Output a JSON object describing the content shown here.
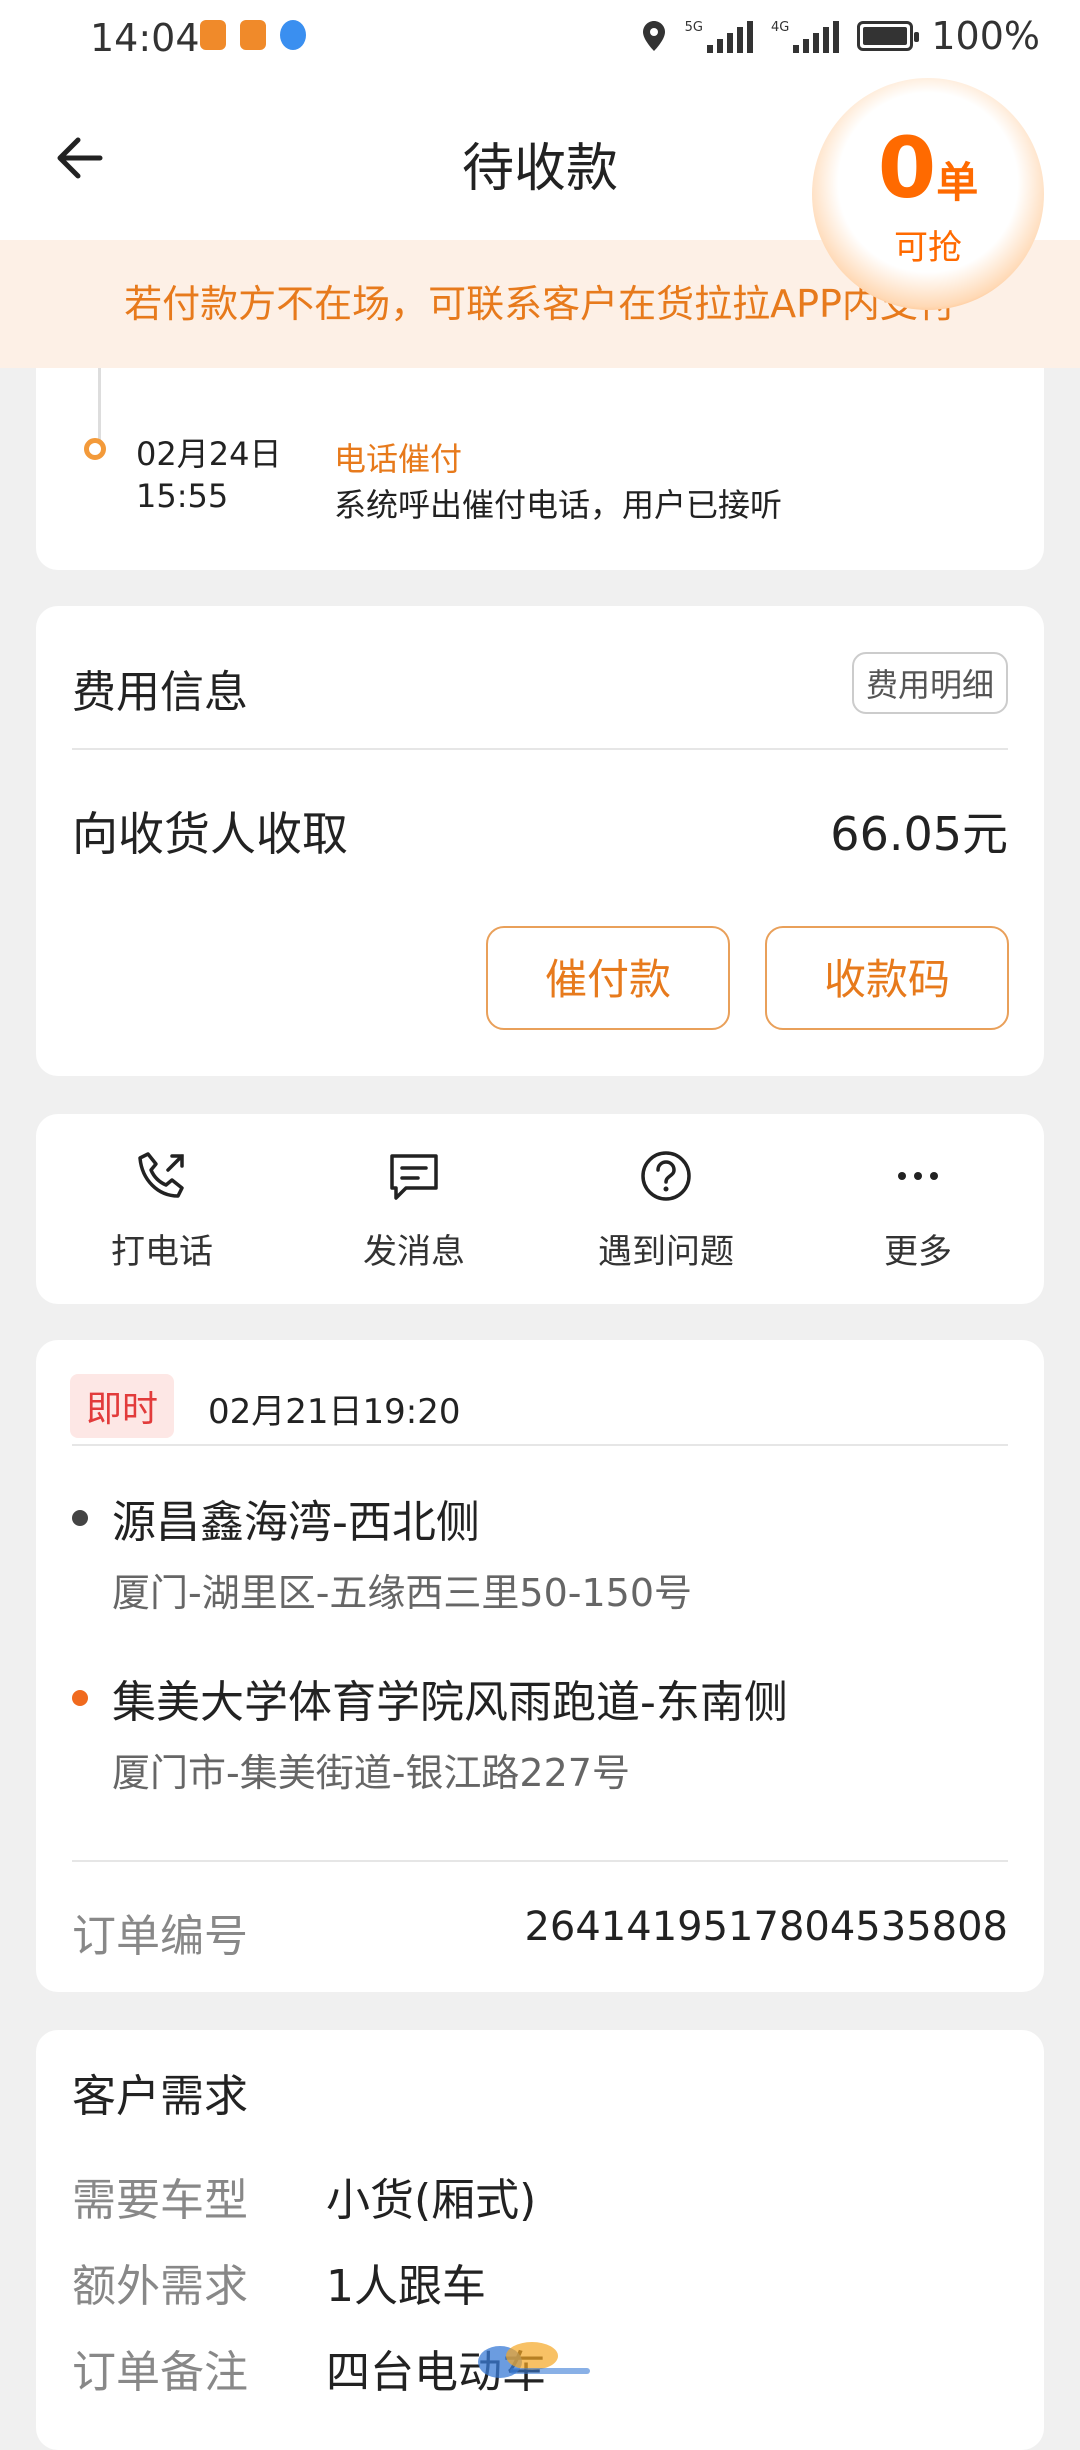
{
  "status_bar": {
    "time": "14:04",
    "battery": "100%",
    "signal_labels": [
      "5G",
      "4G"
    ]
  },
  "header": {
    "title": "待收款"
  },
  "grab_badge": {
    "count": "0",
    "unit": "单",
    "label": "可抢"
  },
  "notice": "若付款方不在场，可联系客户在货拉拉APP内支付",
  "timeline": {
    "date": "02月24日",
    "time": "15:55",
    "status": "电话催付",
    "desc": "系统呼出催付电话，用户已接听"
  },
  "fee": {
    "title": "费用信息",
    "detail_label": "费用明细",
    "collect_label": "向收货人收取",
    "amount": "66.05元",
    "urge_button": "催付款",
    "qr_button": "收款码"
  },
  "actions": [
    {
      "label": "打电话",
      "icon": "phone-icon"
    },
    {
      "label": "发消息",
      "icon": "message-icon"
    },
    {
      "label": "遇到问题",
      "icon": "question-icon"
    },
    {
      "label": "更多",
      "icon": "more-icon"
    }
  ],
  "order": {
    "tag": "即时",
    "time": "02月21日19:20",
    "pickup": {
      "name": "源昌鑫海湾-西北侧",
      "address": "厦门-湖里区-五缘西三里50-150号"
    },
    "dropoff": {
      "name": "集美大学体育学院风雨跑道-东南侧",
      "address": "厦门市-集美街道-银江路227号"
    },
    "number_label": "订单编号",
    "number": "2641419517804535808"
  },
  "requirements": {
    "title": "客户需求",
    "rows": [
      {
        "label": "需要车型",
        "value": "小货(厢式)"
      },
      {
        "label": "额外需求",
        "value": "1人跟车"
      },
      {
        "label": "订单备注",
        "value": "四台电动车"
      }
    ]
  },
  "colors": {
    "accent": "#e77a1c",
    "notice_bg": "#fdf0e6",
    "tag_red": "#e23b3b",
    "dropoff_dot": "#f06a1e",
    "pickup_dot": "#444444"
  }
}
